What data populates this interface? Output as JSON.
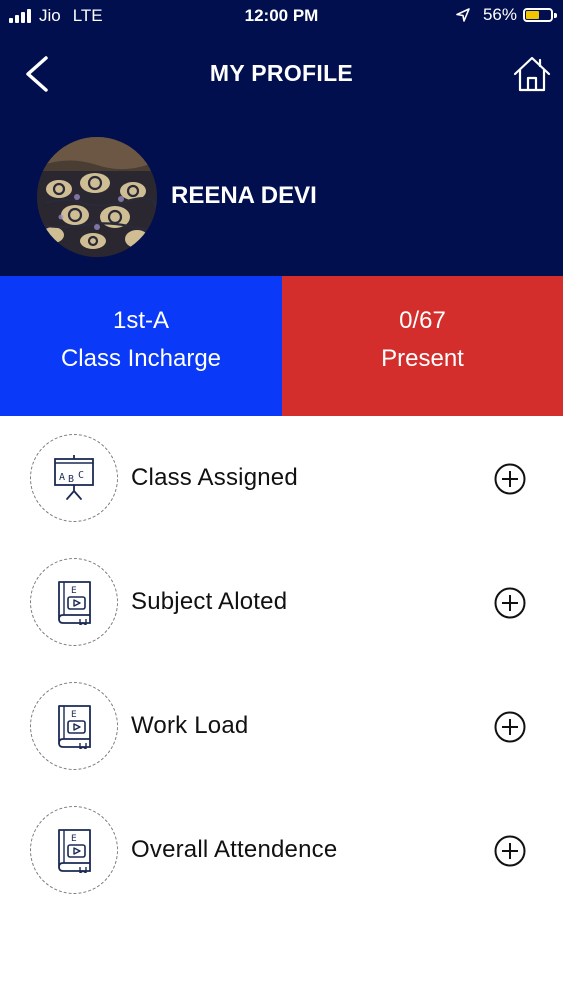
{
  "status_bar": {
    "carrier": "Jio",
    "network": "LTE",
    "time": "12:00 PM",
    "battery": "56%",
    "battery_level": 0.56,
    "battery_color": "#f5c400"
  },
  "nav": {
    "title": "MY PROFILE",
    "back_icon": "chevron-left-icon",
    "home_icon": "home-icon"
  },
  "profile": {
    "name": "REENA DEVI"
  },
  "stats": {
    "class_value": "1st-A",
    "class_label": "Class Incharge",
    "present_value": "0/67",
    "present_label": "Present"
  },
  "menu": [
    {
      "label": "Class Assigned",
      "icon": "abc-board-icon"
    },
    {
      "label": "Subject Aloted",
      "icon": "ebook-icon"
    },
    {
      "label": "Work Load",
      "icon": "ebook-icon"
    },
    {
      "label": "Overall Attendence",
      "icon": "ebook-icon"
    }
  ],
  "colors": {
    "header_bg": "#020f4f",
    "class_bg": "#0a39f7",
    "present_bg": "#d32e2c",
    "icon_stroke": "#1b2a55"
  }
}
